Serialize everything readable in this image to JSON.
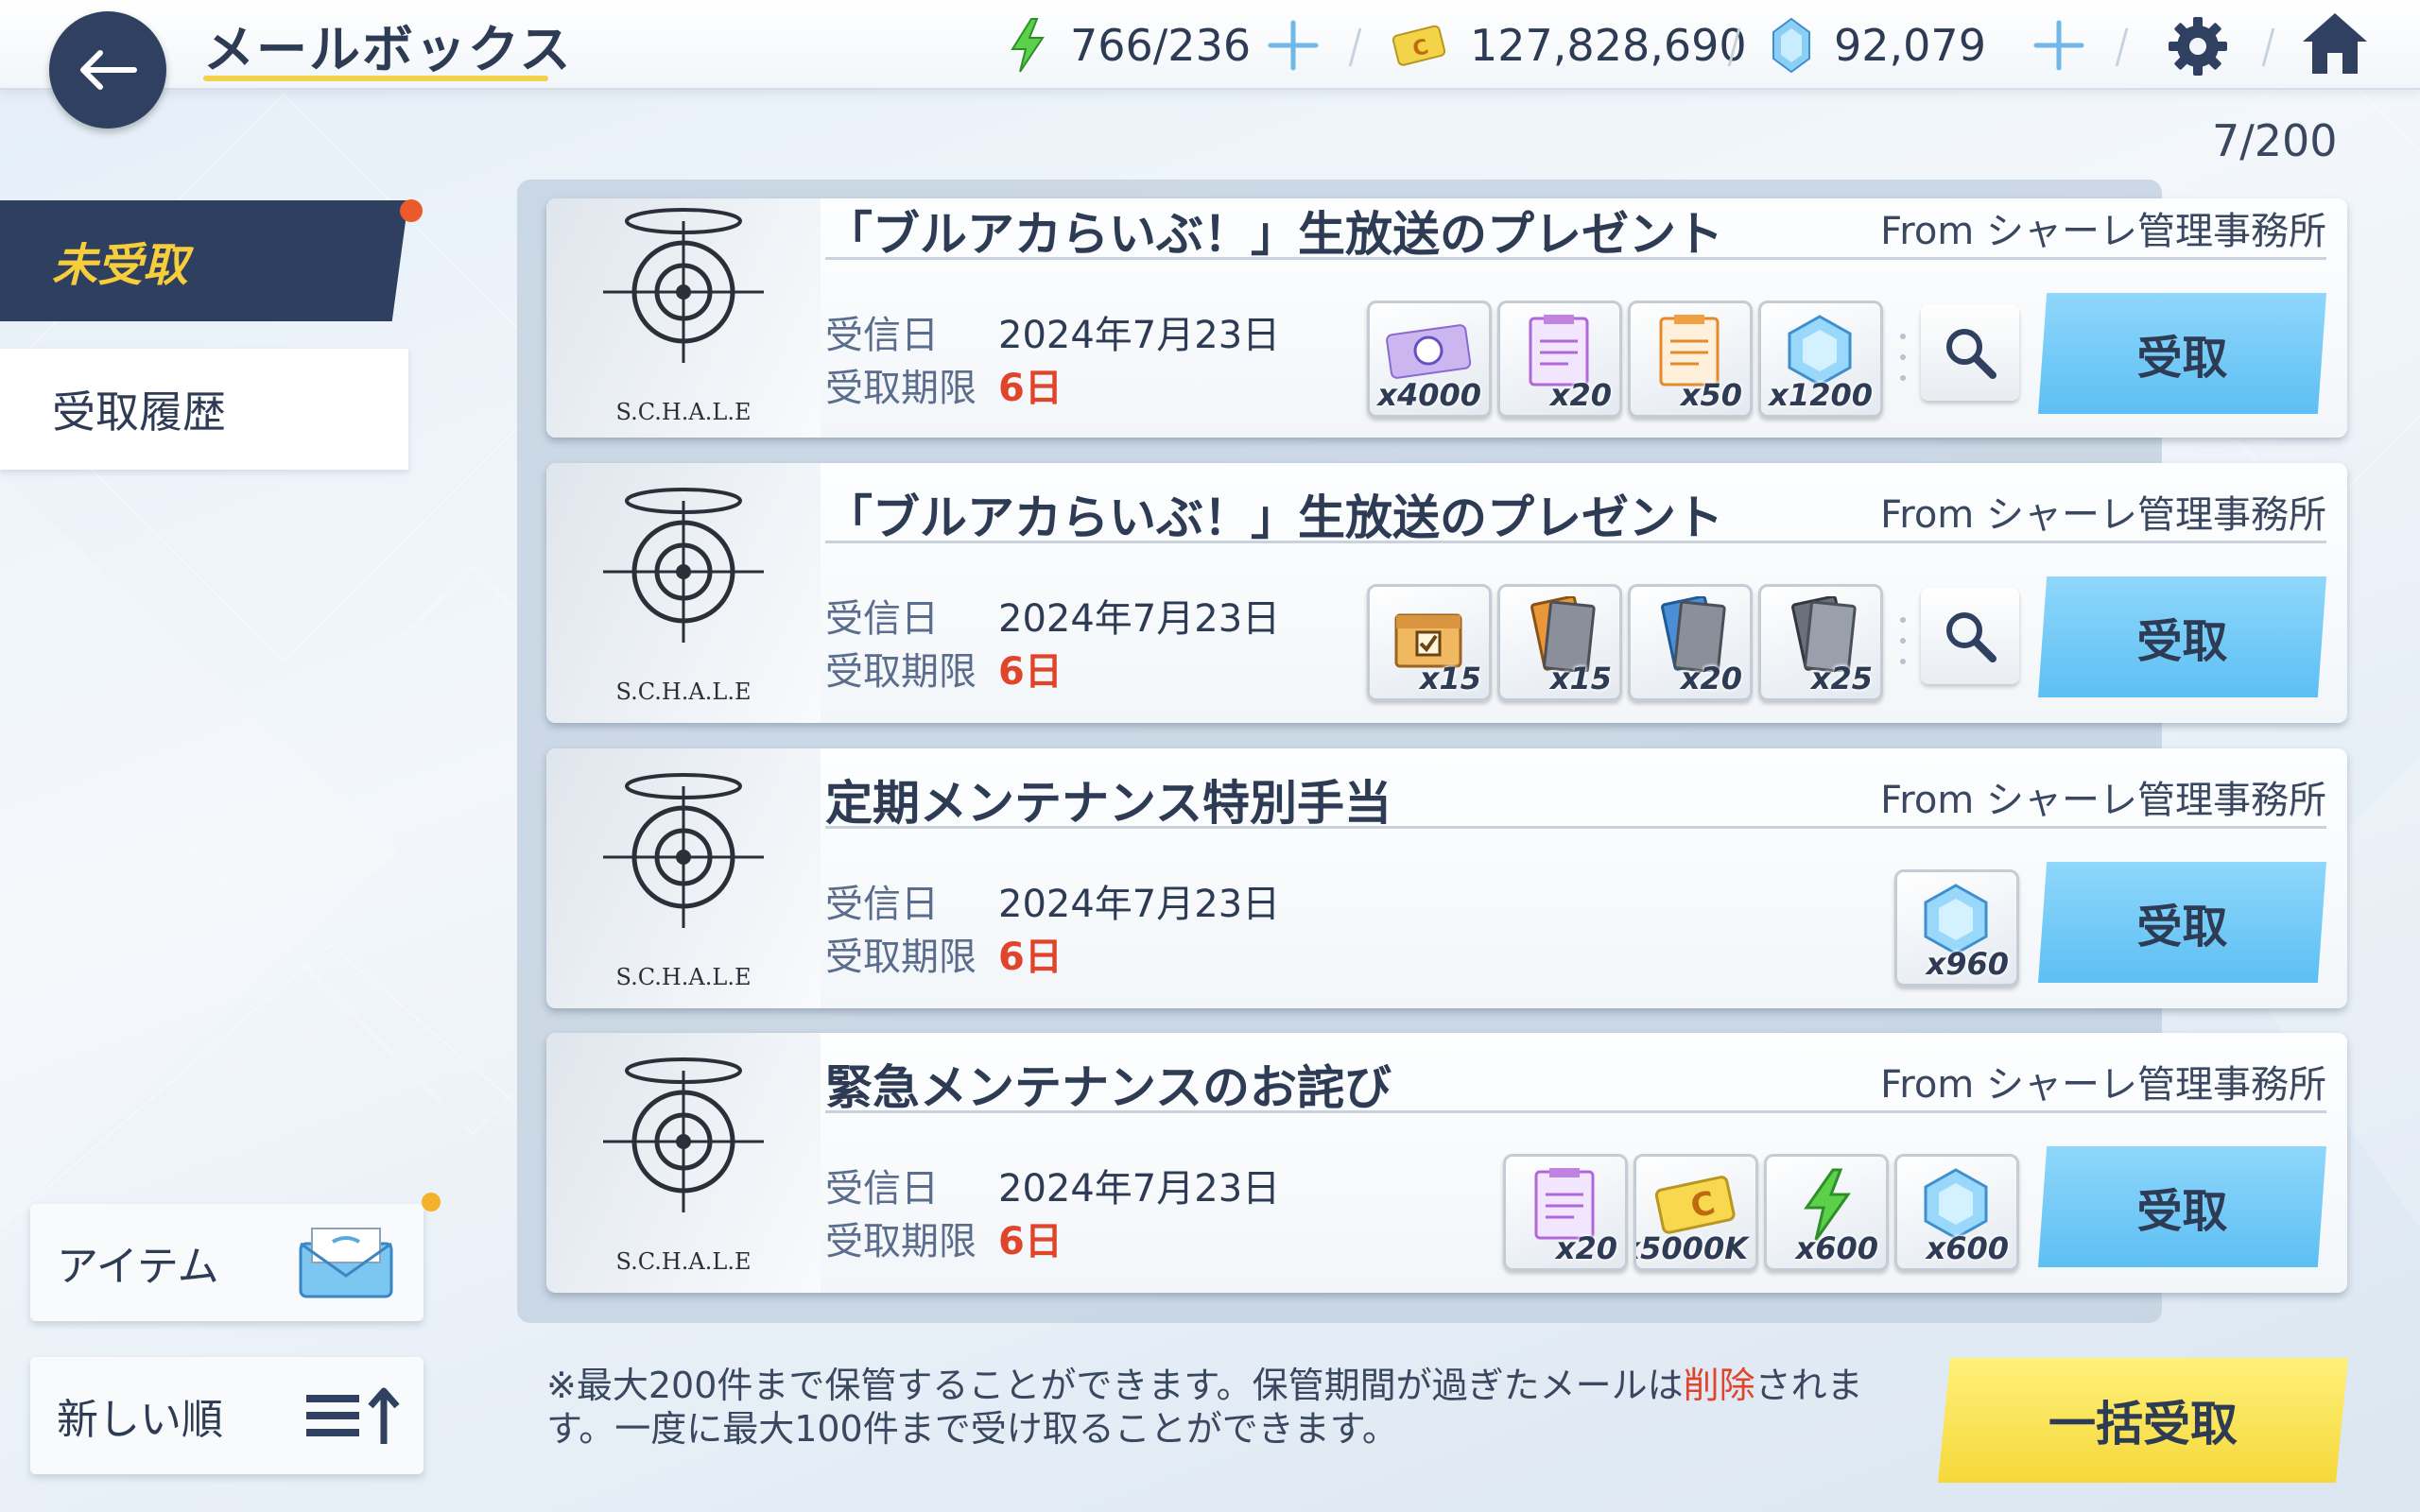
{
  "header": {
    "title": "メールボックス",
    "ap": "766/236",
    "credits": "127,828,690",
    "pyroxene": "92,079"
  },
  "mail_count": "7/200",
  "tabs": {
    "unreceived": "未受取",
    "history": "受取履歴"
  },
  "side": {
    "item_button": "アイテム",
    "sort_button": "新しい順"
  },
  "labels": {
    "received_date": "受信日",
    "deadline": "受取期限",
    "claim": "受取",
    "bulk_claim": "一括受取"
  },
  "mails": [
    {
      "title": "「ブルアカらいぶ！」生放送のプレゼント",
      "from": "From シャーレ管理事務所",
      "logo": "S.C.H.A.L.E",
      "date": "2024年7月23日",
      "deadline": "6日",
      "items": [
        {
          "icon": "ticket-icon",
          "qty": "x4000"
        },
        {
          "icon": "report-purple-icon",
          "qty": "x20"
        },
        {
          "icon": "report-orange-icon",
          "qty": "x50"
        },
        {
          "icon": "pyroxene-icon",
          "qty": "x1200"
        }
      ]
    },
    {
      "title": "「ブルアカらいぶ！」生放送のプレゼント",
      "from": "From シャーレ管理事務所",
      "logo": "S.C.H.A.L.E",
      "date": "2024年7月23日",
      "deadline": "6日",
      "items": [
        {
          "icon": "gift-box-icon",
          "qty": "x15"
        },
        {
          "icon": "orange-book-icon",
          "qty": "x15"
        },
        {
          "icon": "blue-book-icon",
          "qty": "x20"
        },
        {
          "icon": "grey-book-icon",
          "qty": "x25"
        }
      ]
    },
    {
      "title": "定期メンテナンス特別手当",
      "from": "From シャーレ管理事務所",
      "logo": "S.C.H.A.L.E",
      "date": "2024年7月23日",
      "deadline": "6日",
      "items": [
        {
          "icon": "pyroxene-icon",
          "qty": "x960"
        }
      ]
    },
    {
      "title": "緊急メンテナンスのお詫び",
      "from": "From シャーレ管理事務所",
      "logo": "S.C.H.A.L.E",
      "date": "2024年7月23日",
      "deadline": "6日",
      "items": [
        {
          "icon": "report-purple-icon",
          "qty": "x20"
        },
        {
          "icon": "credit-icon",
          "qty": "x5000K"
        },
        {
          "icon": "ap-bolt-icon",
          "qty": "x600"
        },
        {
          "icon": "pyroxene-icon",
          "qty": "x600"
        }
      ]
    }
  ],
  "note": {
    "part1": "※最大200件まで保管することができます。保管期間が過ぎたメールは",
    "warn": "削除",
    "part2": "されます。一度に最大100件まで受け取ることができます。"
  },
  "colors": {
    "accent_yellow": "#f6cd3b",
    "claim_blue": "#5dbff3",
    "deadline_red": "#e0442a",
    "navy": "#2f3f5f"
  }
}
